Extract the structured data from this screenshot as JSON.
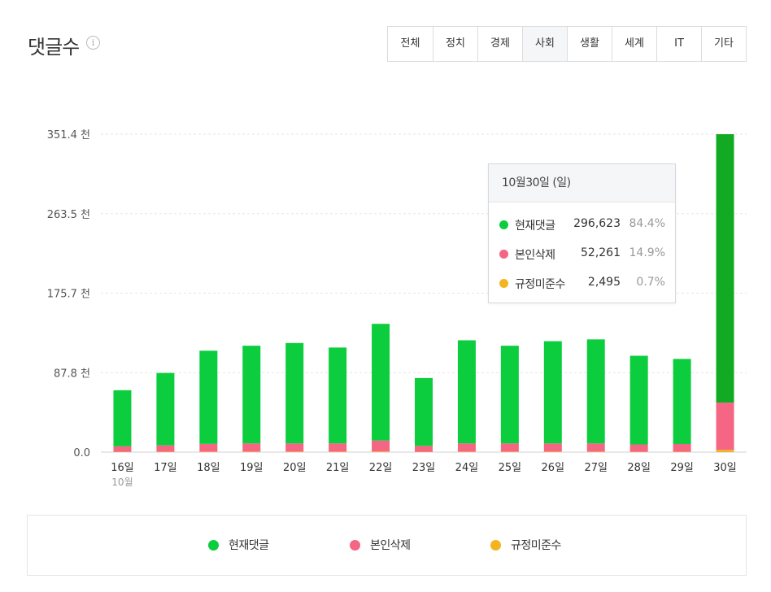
{
  "header": {
    "title": "댓글수",
    "info_icon": "info-icon"
  },
  "tabs": [
    "전체",
    "정치",
    "경제",
    "사회",
    "생활",
    "세계",
    "IT",
    "기타"
  ],
  "active_tab": "사회",
  "tooltip": {
    "title": "10월30일 (일)",
    "rows": [
      {
        "label": "현재댓글",
        "value": "296,623",
        "pct": "84.4%"
      },
      {
        "label": "본인삭제",
        "value": "52,261",
        "pct": "14.9%"
      },
      {
        "label": "규정미준수",
        "value": "2,495",
        "pct": "0.7%"
      }
    ]
  },
  "legend": [
    "현재댓글",
    "본인삭제",
    "규정미준수"
  ],
  "colors": {
    "current": "#0ccd3e",
    "current_highlight": "#11aa22",
    "deleted": "#f46683",
    "violation": "#f4b422"
  },
  "chart_data": {
    "type": "bar",
    "stacked": true,
    "categories": [
      "16일",
      "17일",
      "18일",
      "19일",
      "20일",
      "21일",
      "22일",
      "23일",
      "24일",
      "25일",
      "26일",
      "27일",
      "28일",
      "29일",
      "30일"
    ],
    "x_sublabel": {
      "index": 0,
      "text": "10월"
    },
    "series": [
      {
        "name": "현재댓글",
        "values": [
          62000,
          80000,
          103000,
          108000,
          111000,
          106000,
          129000,
          75000,
          114000,
          108000,
          113000,
          115000,
          98000,
          94000,
          296623
        ]
      },
      {
        "name": "본인삭제",
        "values": [
          6000,
          7000,
          8500,
          9000,
          9000,
          9000,
          12000,
          6500,
          9000,
          9000,
          9000,
          9000,
          8000,
          8500,
          52261
        ]
      },
      {
        "name": "규정미준수",
        "values": [
          400,
          500,
          600,
          600,
          600,
          600,
          800,
          400,
          600,
          600,
          600,
          600,
          500,
          500,
          2495
        ]
      }
    ],
    "ylim": [
      0,
      351400
    ],
    "yticks": [
      0,
      87800,
      175700,
      263500,
      351400
    ],
    "ytick_labels": [
      "0.0",
      "87.8 천",
      "175.7 천",
      "263.5 천",
      "351.4 천"
    ],
    "highlight_index": 14,
    "grid": true,
    "legend_position": "bottom"
  }
}
